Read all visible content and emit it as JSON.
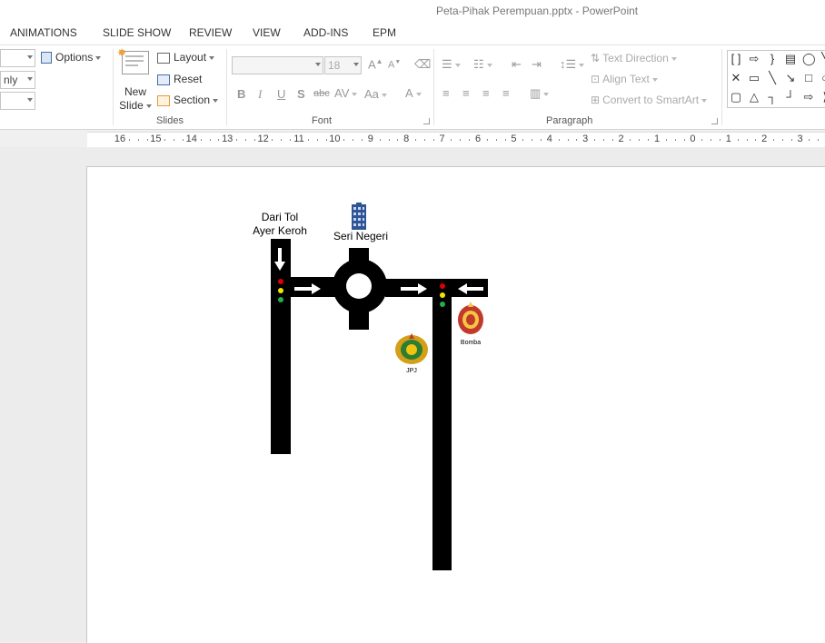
{
  "window": {
    "title": "Peta-Pihak Perempuan.pptx - PowerPoint"
  },
  "tabs": [
    "ANIMATIONS",
    "SLIDE SHOW",
    "REVIEW",
    "VIEW",
    "ADD-INS",
    "EPM"
  ],
  "ribbon": {
    "left_partial": {
      "combo2_value": "nly",
      "options_label": "Options"
    },
    "slides": {
      "new_slide_label1": "New",
      "new_slide_label2": "Slide",
      "layout_label": "Layout",
      "reset_label": "Reset",
      "section_label": "Section",
      "group_label": "Slides"
    },
    "font": {
      "font_size": "18",
      "bold": "B",
      "italic": "I",
      "underline": "U",
      "shadow": "S",
      "strike": "abc",
      "spacing": "AV",
      "case": "Aa",
      "color": "A",
      "grow": "A",
      "shrink": "A",
      "group_label": "Font"
    },
    "paragraph": {
      "text_direction": "Text Direction",
      "align_text": "Align Text",
      "convert_smartart": "Convert to SmartArt",
      "group_label": "Paragraph"
    }
  },
  "ruler": {
    "numbers": [
      "16",
      "15",
      "14",
      "13",
      "12",
      "11",
      "10",
      "9",
      "8",
      "7",
      "6",
      "5",
      "4",
      "3",
      "2",
      "1",
      "0",
      "1",
      "2",
      "3"
    ]
  },
  "slide": {
    "label_from_toll_line1": "Dari Tol",
    "label_from_toll_line2": "Ayer Keroh",
    "label_seri_negeri": "Seri Negeri",
    "label_jpj": "JPJ",
    "label_bomba": "Bomba",
    "colors": {
      "road": "#000000",
      "light_red": "#e00000",
      "light_yellow": "#f2e600",
      "light_green": "#22b14c",
      "building": "#2f5597"
    }
  }
}
